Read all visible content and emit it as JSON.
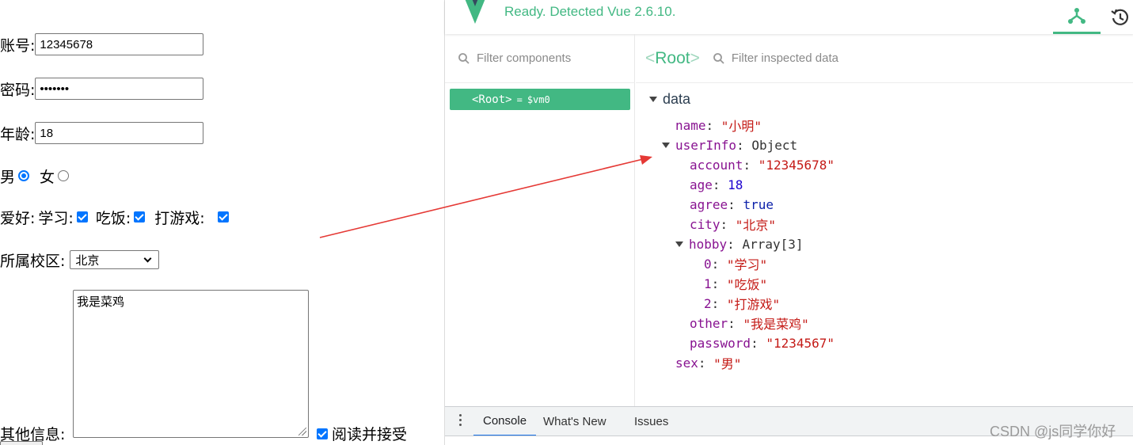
{
  "form": {
    "account_label": "账号:",
    "account_value": "12345678",
    "password_label": "密码:",
    "password_value": "•••••••",
    "age_label": "年龄:",
    "age_value": "18",
    "male_label": "男",
    "female_label": "女",
    "hobby_label": "爱好:",
    "hobby_study": "学习:",
    "hobby_eat": "吃饭:",
    "hobby_game": "打游戏:",
    "campus_label": "所属校区:",
    "campus_value": "北京",
    "other_label": "其他信息:",
    "other_value": "我是菜鸡",
    "agree_label": "阅读并接受"
  },
  "devtools": {
    "status": "Ready. Detected Vue 2.6.10.",
    "filter_components_placeholder": "Filter components",
    "filter_data_placeholder": "Filter inspected data",
    "root_tag": "Root",
    "root_item": {
      "name": "<Root>",
      "eq": "=",
      "vm": "$vm0"
    },
    "section": "data",
    "tree": [
      {
        "key": "name",
        "value": "\"小明\"",
        "type": "s"
      },
      {
        "key": "userInfo",
        "value": "Object",
        "type": "o"
      },
      {
        "key": "account",
        "value": "\"12345678\"",
        "type": "s"
      },
      {
        "key": "age",
        "value": "18",
        "type": "n"
      },
      {
        "key": "agree",
        "value": "true",
        "type": "b"
      },
      {
        "key": "city",
        "value": "\"北京\"",
        "type": "s"
      },
      {
        "key": "hobby",
        "value": "Array[3]",
        "type": "o"
      },
      {
        "key": "0",
        "value": "\"学习\"",
        "type": "s"
      },
      {
        "key": "1",
        "value": "\"吃饭\"",
        "type": "s"
      },
      {
        "key": "2",
        "value": "\"打游戏\"",
        "type": "s"
      },
      {
        "key": "other",
        "value": "\"我是菜鸡\"",
        "type": "s"
      },
      {
        "key": "password",
        "value": "\"1234567\"",
        "type": "s"
      },
      {
        "key": "sex",
        "value": "\"男\"",
        "type": "s"
      }
    ]
  },
  "console_bar": {
    "tab_console": "Console",
    "tab_whats_new": "What's New",
    "tab_issues": "Issues"
  },
  "watermark": "CSDN @js同学你好",
  "colors": {
    "vue_green": "#42b883",
    "vue_dark": "#35495e",
    "arrow_red": "#e53935",
    "check_blue": "#0075ff"
  }
}
